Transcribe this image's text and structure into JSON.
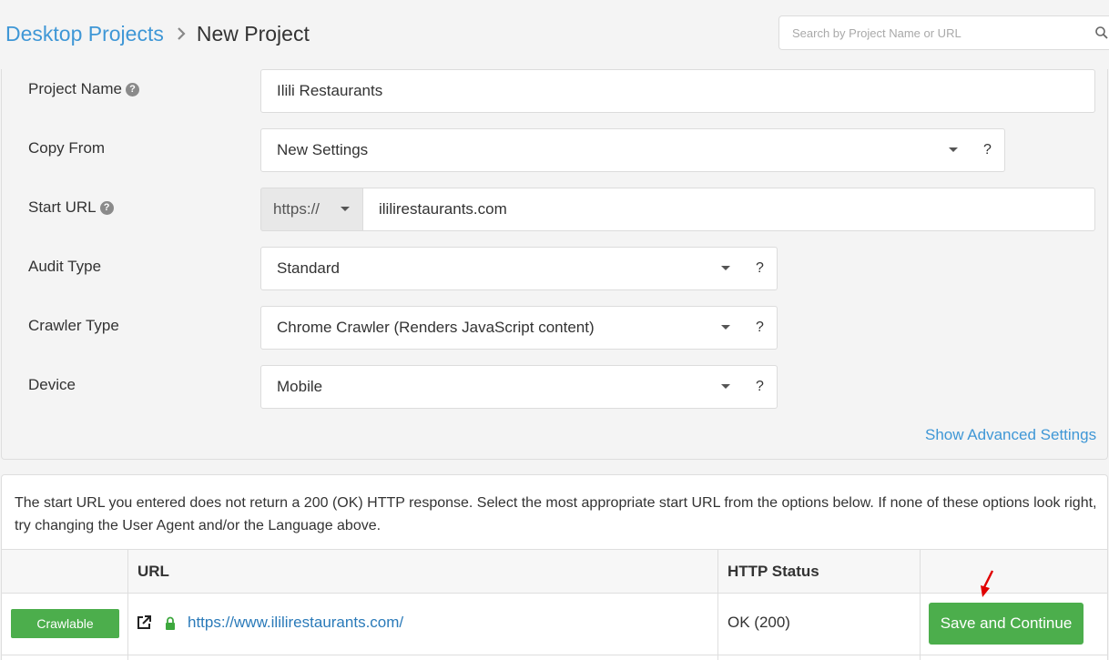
{
  "breadcrumb": {
    "root": "Desktop Projects",
    "separator": ">",
    "current": "New Project"
  },
  "search": {
    "placeholder": "Search by Project Name or URL",
    "value": ""
  },
  "form": {
    "project_name": {
      "label": "Project Name",
      "value": "Ilili Restaurants"
    },
    "copy_from": {
      "label": "Copy From",
      "value": "New Settings",
      "help": "?"
    },
    "start_url": {
      "label": "Start URL",
      "protocol": "https://",
      "value": "ililirestaurants.com"
    },
    "audit_type": {
      "label": "Audit Type",
      "value": "Standard",
      "help": "?"
    },
    "crawler_type": {
      "label": "Crawler Type",
      "value": "Chrome Crawler (Renders JavaScript content)",
      "help": "?"
    },
    "device": {
      "label": "Device",
      "value": "Mobile",
      "help": "?"
    },
    "advanced_link": "Show Advanced Settings"
  },
  "results": {
    "notice": "The start URL you entered does not return a 200 (OK) HTTP response. Select the most appropriate start URL from the options below. If none of these options look right, try changing the User Agent and/or the Language above.",
    "columns": {
      "url": "URL",
      "status": "HTTP Status"
    },
    "row": {
      "badge": "Crawlable",
      "url": "https://www.ililirestaurants.com/",
      "status": "OK (200)",
      "action": "Save and Continue"
    }
  },
  "colors": {
    "accent": "#3f97d6",
    "success": "#4cae4c",
    "link": "#2a7ab9",
    "annotation": "#e00000"
  }
}
